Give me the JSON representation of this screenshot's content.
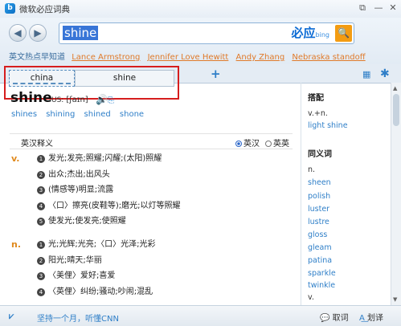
{
  "window": {
    "title": "微软必应词典",
    "app_icon_letter": "b",
    "controls": [
      "⧉",
      "—",
      "✕"
    ]
  },
  "nav": {
    "back_icon": "◀",
    "forward_icon": "▶"
  },
  "search": {
    "query": "shine",
    "brand_cn": "必应",
    "brand_en": "bing",
    "go_icon": "🔍"
  },
  "hot": {
    "label": "英文热点早知道",
    "items": [
      "Lance Armstrong",
      "Jennifer Love Hewitt",
      "Andy Zhang",
      "Nebraska standoff"
    ]
  },
  "tabs": [
    {
      "label": "china"
    },
    {
      "label": "shine"
    }
  ],
  "tab_add_icon": "+",
  "toolbar": {
    "wordbook_icon": "▦",
    "settings_icon": "✱"
  },
  "entry": {
    "word": "shine",
    "pron_label": "US:",
    "ipa": "[ʃaɪn]",
    "forms": [
      "shines",
      "shining",
      "shined",
      "shone"
    ]
  },
  "section": {
    "title": "英汉释义",
    "opt1": "英汉",
    "opt2": "英英",
    "selected": "英汉"
  },
  "senses": [
    {
      "pos": "v.",
      "defs": [
        "发光;发亮;照耀;闪耀;(太阳)照耀",
        "出众;杰出;出风头",
        "(情感等)明显;流露",
        "〈口〉擦亮(皮鞋等);磨光;以灯等照耀",
        "使发光;使发亮;使照耀"
      ]
    },
    {
      "pos": "n.",
      "defs": [
        "光;光辉;光亮;〈口〉光泽;光彩",
        "阳光;晴天;华丽",
        "〈美俚〉爱好;喜爱",
        "〈英俚〉纠纷;骚动;吵闹;混乱"
      ]
    }
  ],
  "side": {
    "collocation_title": "搭配",
    "collocation_type": "v.+n.",
    "collocation_item": "light shine",
    "synonym_title": "同义词",
    "synonym_pos_n": "n.",
    "synonyms_n": [
      "sheen",
      "polish",
      "luster",
      "lustre",
      "gloss",
      "gleam",
      "patina",
      "sparkle",
      "twinkle"
    ],
    "synonym_pos_v": "v."
  },
  "status": {
    "ad": "坚持一个月，听懂CNN",
    "pick_word": "取词",
    "translate_selection": "划译"
  },
  "colors": {
    "accent": "#2f7fc8",
    "pos": "#e08a1e",
    "highlight_box": "#d61e1e",
    "hot": "#e07a2a"
  }
}
